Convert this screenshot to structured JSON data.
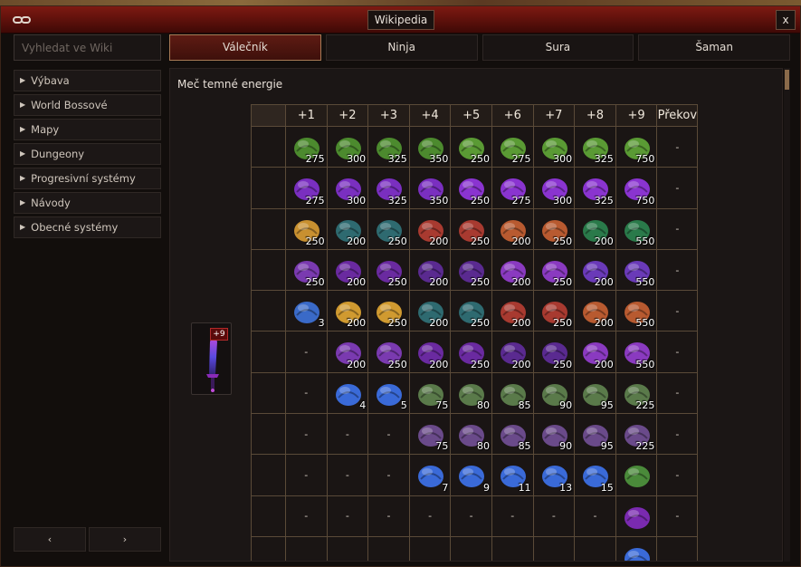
{
  "window": {
    "title": "Wikipedia",
    "close_label": "x"
  },
  "search": {
    "placeholder": "Vyhledat ve Wiki"
  },
  "sidebar": {
    "items": [
      {
        "label": "Výbava"
      },
      {
        "label": "World Bossové"
      },
      {
        "label": "Mapy"
      },
      {
        "label": "Dungeony"
      },
      {
        "label": "Progresivní systémy"
      },
      {
        "label": "Návody"
      },
      {
        "label": "Obecné systémy"
      }
    ],
    "prev_label": "‹",
    "next_label": "›"
  },
  "tabs": [
    {
      "label": "Válečník",
      "active": true
    },
    {
      "label": "Ninja",
      "active": false
    },
    {
      "label": "Sura",
      "active": false
    },
    {
      "label": "Šaman",
      "active": false
    }
  ],
  "item": {
    "name": "Meč temné energie",
    "badge": "+9"
  },
  "table": {
    "headers": [
      "+1",
      "+2",
      "+3",
      "+4",
      "+5",
      "+6",
      "+7",
      "+8",
      "+9",
      "Překov"
    ],
    "rows": [
      [
        {
          "c": "#4c8a2e",
          "n": "275"
        },
        {
          "c": "#4c8a2e",
          "n": "300"
        },
        {
          "c": "#4c8a2e",
          "n": "325"
        },
        {
          "c": "#4c8a2e",
          "n": "350"
        },
        {
          "c": "#5a9a34",
          "n": "250"
        },
        {
          "c": "#5a9a34",
          "n": "275"
        },
        {
          "c": "#5a9a34",
          "n": "300"
        },
        {
          "c": "#5a9a34",
          "n": "325"
        },
        {
          "c": "#5a9a34",
          "n": "750"
        },
        {
          "d": "-"
        }
      ],
      [
        {
          "c": "#7a2fc0",
          "n": "275"
        },
        {
          "c": "#7a2fc0",
          "n": "300"
        },
        {
          "c": "#7a2fc0",
          "n": "325"
        },
        {
          "c": "#7a2fc0",
          "n": "350"
        },
        {
          "c": "#8a34d0",
          "n": "250"
        },
        {
          "c": "#8a34d0",
          "n": "275"
        },
        {
          "c": "#8a34d0",
          "n": "300"
        },
        {
          "c": "#8a34d0",
          "n": "325"
        },
        {
          "c": "#8a34d0",
          "n": "750"
        },
        {
          "d": "-"
        }
      ],
      [
        {
          "c": "#c89030",
          "n": "250"
        },
        {
          "c": "#2e6a70",
          "n": "200"
        },
        {
          "c": "#2e6a70",
          "n": "250"
        },
        {
          "c": "#a83a30",
          "n": "200"
        },
        {
          "c": "#a83a30",
          "n": "250"
        },
        {
          "c": "#b85a30",
          "n": "200"
        },
        {
          "c": "#b85a30",
          "n": "250"
        },
        {
          "c": "#2a7a4a",
          "n": "200"
        },
        {
          "c": "#2a7a4a",
          "n": "550"
        },
        {
          "d": "-"
        }
      ],
      [
        {
          "c": "#7a3ab0",
          "n": "250"
        },
        {
          "c": "#6a2aa0",
          "n": "200"
        },
        {
          "c": "#6a2aa0",
          "n": "250"
        },
        {
          "c": "#5a2a90",
          "n": "200"
        },
        {
          "c": "#5a2a90",
          "n": "250"
        },
        {
          "c": "#8a3ac0",
          "n": "200"
        },
        {
          "c": "#8a3ac0",
          "n": "250"
        },
        {
          "c": "#6a3ab8",
          "n": "200"
        },
        {
          "c": "#6a3ab8",
          "n": "550"
        },
        {
          "d": "-"
        }
      ],
      [
        {
          "c": "#3a6ac8",
          "n": "3"
        },
        {
          "c": "#d09a30",
          "n": "200"
        },
        {
          "c": "#d09a30",
          "n": "250"
        },
        {
          "c": "#2e6a70",
          "n": "200"
        },
        {
          "c": "#2e6a70",
          "n": "250"
        },
        {
          "c": "#a83a30",
          "n": "200"
        },
        {
          "c": "#a83a30",
          "n": "250"
        },
        {
          "c": "#b85a30",
          "n": "200"
        },
        {
          "c": "#b85a30",
          "n": "550"
        },
        {
          "d": "-"
        }
      ],
      [
        {
          "d": "-"
        },
        {
          "c": "#7a3ab0",
          "n": "200"
        },
        {
          "c": "#7a3ab0",
          "n": "250"
        },
        {
          "c": "#6a2aa0",
          "n": "200"
        },
        {
          "c": "#6a2aa0",
          "n": "250"
        },
        {
          "c": "#5a2a90",
          "n": "200"
        },
        {
          "c": "#5a2a90",
          "n": "250"
        },
        {
          "c": "#8a3ac0",
          "n": "200"
        },
        {
          "c": "#8a3ac0",
          "n": "550"
        },
        {
          "d": "-"
        }
      ],
      [
        {
          "d": "-"
        },
        {
          "c": "#3a6ad8",
          "n": "4"
        },
        {
          "c": "#3a6ad8",
          "n": "5"
        },
        {
          "c": "#5a7a4a",
          "n": "75"
        },
        {
          "c": "#5a7a4a",
          "n": "80"
        },
        {
          "c": "#5a7a4a",
          "n": "85"
        },
        {
          "c": "#5a7a4a",
          "n": "90"
        },
        {
          "c": "#5a7a4a",
          "n": "95"
        },
        {
          "c": "#5a7a4a",
          "n": "225"
        },
        {
          "d": "-"
        }
      ],
      [
        {
          "d": "-"
        },
        {
          "d": "-"
        },
        {
          "d": "-"
        },
        {
          "c": "#6a4a8a",
          "n": "75"
        },
        {
          "c": "#6a4a8a",
          "n": "80"
        },
        {
          "c": "#6a4a8a",
          "n": "85"
        },
        {
          "c": "#6a4a8a",
          "n": "90"
        },
        {
          "c": "#6a4a8a",
          "n": "95"
        },
        {
          "c": "#6a4a8a",
          "n": "225"
        },
        {
          "d": "-"
        }
      ],
      [
        {
          "d": "-"
        },
        {
          "d": "-"
        },
        {
          "d": "-"
        },
        {
          "c": "#3a6ad8",
          "n": "7"
        },
        {
          "c": "#3a6ad8",
          "n": "9"
        },
        {
          "c": "#3a6ad8",
          "n": "11"
        },
        {
          "c": "#3a6ad8",
          "n": "13"
        },
        {
          "c": "#3a6ad8",
          "n": "15"
        },
        {
          "c": "#4a8a3a",
          "n": ""
        },
        {
          "d": "-"
        }
      ],
      [
        {
          "d": "-"
        },
        {
          "d": "-"
        },
        {
          "d": "-"
        },
        {
          "d": "-"
        },
        {
          "d": "-"
        },
        {
          "d": "-"
        },
        {
          "d": "-"
        },
        {
          "d": "-"
        },
        {
          "c": "#7a2ab0",
          "n": ""
        },
        {
          "d": "-"
        }
      ],
      [
        {
          "e": 1
        },
        {
          "e": 1
        },
        {
          "e": 1
        },
        {
          "e": 1
        },
        {
          "e": 1
        },
        {
          "e": 1
        },
        {
          "e": 1
        },
        {
          "e": 1
        },
        {
          "c": "#3a6ad8",
          "n": ""
        },
        {
          "e": 1
        }
      ]
    ]
  }
}
